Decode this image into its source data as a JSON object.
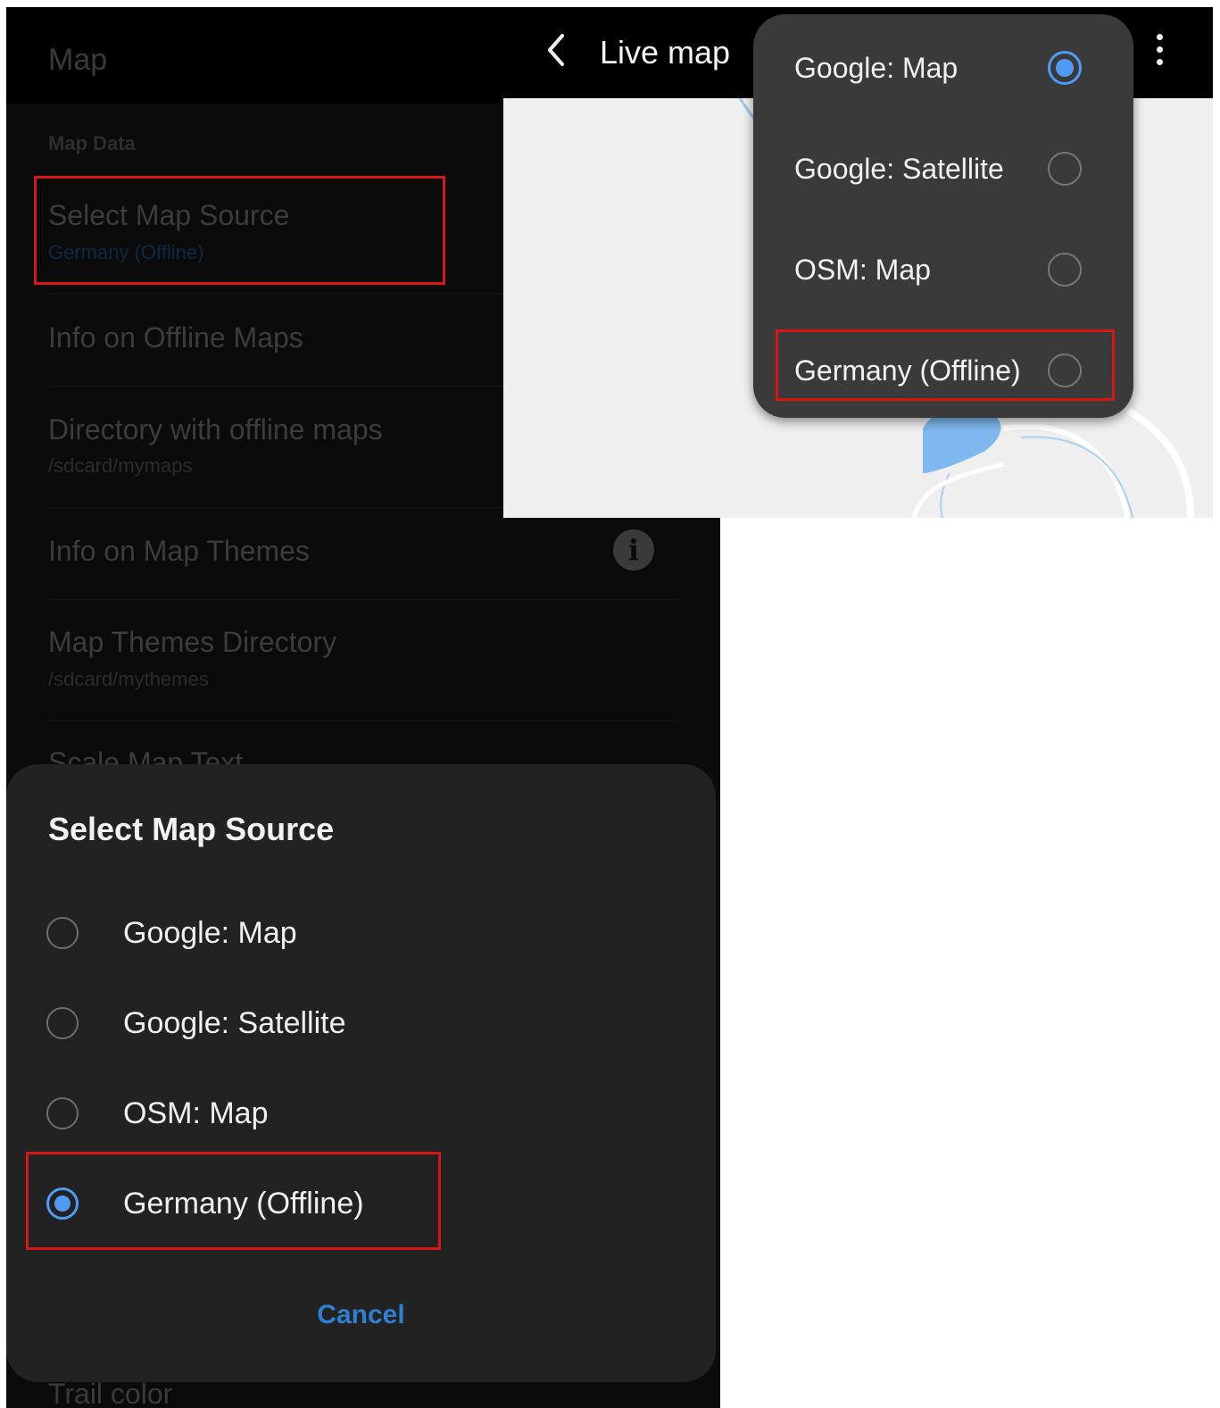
{
  "settings": {
    "title": "Map",
    "category": "Map Data",
    "items": [
      {
        "title": "Select Map Source",
        "summary": "Germany (Offline)"
      },
      {
        "title": "Info on Offline Maps"
      },
      {
        "title": "Directory with offline maps",
        "summary": "/sdcard/mymaps"
      },
      {
        "title": "Info on Map Themes"
      },
      {
        "title": "Map Themes Directory",
        "summary": "/sdcard/mythemes"
      },
      {
        "title": "Scale Map Text"
      },
      {
        "title": "Trail color"
      }
    ],
    "info_icon_glyph": "i"
  },
  "dialog": {
    "title": "Select Map Source",
    "options": [
      {
        "label": "Google: Map",
        "selected": false
      },
      {
        "label": "Google: Satellite",
        "selected": false
      },
      {
        "label": "OSM: Map",
        "selected": false
      },
      {
        "label": "Germany (Offline)",
        "selected": true
      }
    ],
    "cancel_label": "Cancel"
  },
  "livemap": {
    "title": "Live map",
    "options": [
      {
        "label": "Google: Map",
        "selected": true
      },
      {
        "label": "Google: Satellite",
        "selected": false
      },
      {
        "label": "OSM: Map",
        "selected": false
      },
      {
        "label": "Germany (Offline)",
        "selected": false
      }
    ]
  },
  "colors": {
    "accent": "#4f9cf5",
    "cancel": "#2f7fd0",
    "highlight": "#d81616",
    "dialog_bg": "#222222",
    "popup_bg": "#3a3a3a"
  },
  "icons": [
    "info-icon",
    "back-arrow-icon",
    "more-vert-icon",
    "radio-button-icon"
  ]
}
